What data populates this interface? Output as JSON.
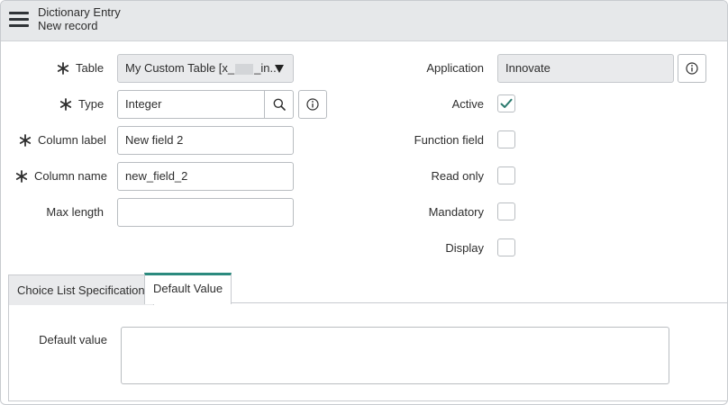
{
  "header": {
    "title": "Dictionary Entry",
    "subtitle": "New record"
  },
  "form": {
    "table": {
      "label": "Table",
      "required": true,
      "value_prefix": "My Custom Table [x_",
      "value_suffix": "_in.."
    },
    "type": {
      "label": "Type",
      "required": true,
      "value": "Integer"
    },
    "column_label": {
      "label": "Column label",
      "required": true,
      "value": "New field 2"
    },
    "column_name": {
      "label": "Column name",
      "required": true,
      "value": "new_field_2"
    },
    "max_length": {
      "label": "Max length",
      "required": false,
      "value": ""
    },
    "application": {
      "label": "Application",
      "value": "Innovate"
    },
    "active": {
      "label": "Active",
      "checked": true
    },
    "function_field": {
      "label": "Function field",
      "checked": false
    },
    "read_only": {
      "label": "Read only",
      "checked": false
    },
    "mandatory": {
      "label": "Mandatory",
      "checked": false
    },
    "display": {
      "label": "Display",
      "checked": false
    }
  },
  "tabs": [
    {
      "label": "Choice List Specification",
      "active": false
    },
    {
      "label": "Default Value",
      "active": true
    }
  ],
  "default_value_section": {
    "label": "Default value",
    "value": ""
  },
  "colors": {
    "accent": "#2b8a7e",
    "header_bg": "#e6e8ea",
    "readonly_bg": "#e9eaec",
    "checkmark": "#2b7a6e"
  },
  "icons": {
    "menu": "hamburger-menu-icon",
    "required": "asterisk-required-icon",
    "search": "magnifier-icon",
    "info": "info-circle-icon",
    "dropdown": "caret-down-icon",
    "check": "checkmark-icon"
  }
}
